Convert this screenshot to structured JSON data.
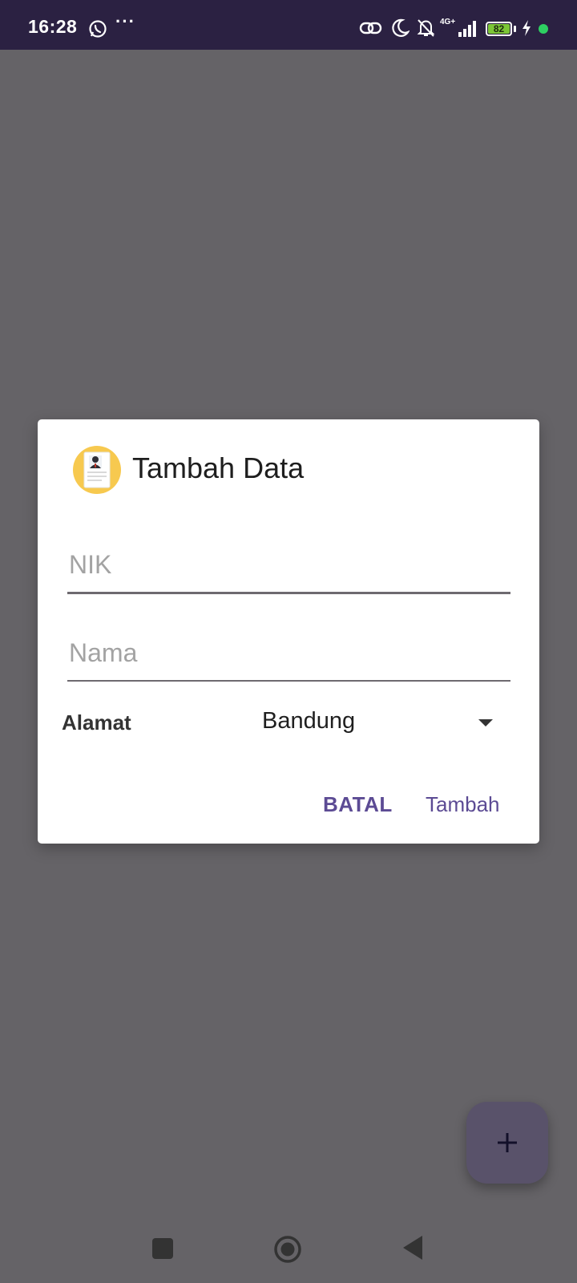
{
  "status_bar": {
    "time": "16:28",
    "network": "4G+",
    "battery": "82",
    "icons": [
      "whatsapp-icon",
      "more-dots-icon",
      "link-icon",
      "moon-icon",
      "bell-off-icon",
      "signal-icon",
      "battery-icon",
      "charging-icon",
      "dot-icon"
    ]
  },
  "dialog": {
    "icon": "resume-document-icon",
    "title": "Tambah Data",
    "nik_placeholder": "NIK",
    "nama_placeholder": "Nama",
    "alamat_label": "Alamat",
    "alamat_selected": "Bandung",
    "cancel_label": "BATAL",
    "submit_label": "Tambah"
  },
  "fab": {
    "icon": "plus-icon"
  },
  "nav_bar": {
    "icons": [
      "recents-square-icon",
      "home-circle-icon",
      "back-triangle-icon"
    ]
  },
  "colors": {
    "status_bar": "#2b2142",
    "scrim": "#656367",
    "accent": "#5c4b94",
    "fab": "#59526a",
    "icon_circle": "#f7c94f",
    "battery": "#7cc636"
  }
}
